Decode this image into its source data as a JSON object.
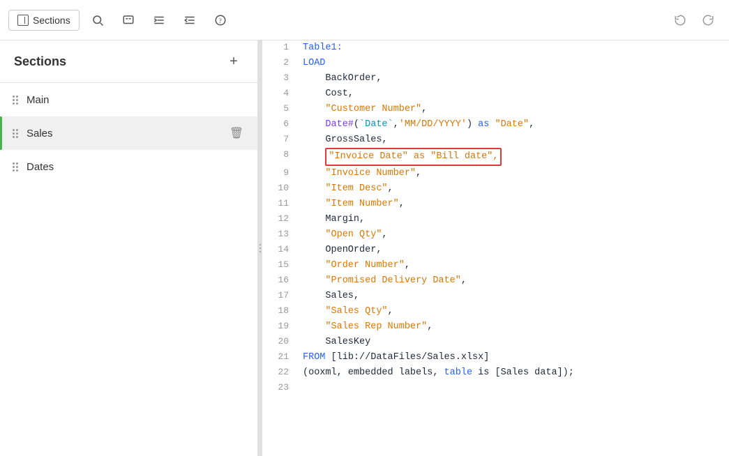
{
  "toolbar": {
    "sections_label": "Sections",
    "icons": [
      {
        "name": "search-icon",
        "symbol": "🔍"
      },
      {
        "name": "comment-icon",
        "symbol": "//"
      },
      {
        "name": "indent-icon",
        "symbol": "⇥"
      },
      {
        "name": "outdent-icon",
        "symbol": "⇤"
      },
      {
        "name": "help-icon",
        "symbol": "?"
      },
      {
        "name": "undo-icon",
        "symbol": "↩"
      },
      {
        "name": "redo-icon",
        "symbol": "↪"
      }
    ]
  },
  "sidebar": {
    "title": "Sections",
    "add_label": "+",
    "items": [
      {
        "name": "Main",
        "active": false
      },
      {
        "name": "Sales",
        "active": true
      },
      {
        "name": "Dates",
        "active": false
      }
    ]
  },
  "editor": {
    "lines": [
      {
        "num": 1,
        "tokens": [
          {
            "text": "Table1:",
            "color": "blue"
          }
        ]
      },
      {
        "num": 2,
        "tokens": [
          {
            "text": "LOAD",
            "color": "blue"
          }
        ]
      },
      {
        "num": 3,
        "tokens": [
          {
            "text": "    BackOrder",
            "color": "dark"
          },
          {
            "text": ",",
            "color": "dark"
          }
        ]
      },
      {
        "num": 4,
        "tokens": [
          {
            "text": "    Cost",
            "color": "dark"
          },
          {
            "text": ",",
            "color": "dark"
          }
        ]
      },
      {
        "num": 5,
        "tokens": [
          {
            "text": "    ",
            "color": "dark"
          },
          {
            "text": "\"Customer Number\"",
            "color": "orange"
          },
          {
            "text": ",",
            "color": "dark"
          }
        ]
      },
      {
        "num": 6,
        "tokens": [
          {
            "text": "    ",
            "color": "dark"
          },
          {
            "text": "Date#",
            "color": "purple"
          },
          {
            "text": "(",
            "color": "dark"
          },
          {
            "text": "`Date`",
            "color": "teal"
          },
          {
            "text": ",",
            "color": "dark"
          },
          {
            "text": "'MM/DD/YYYY'",
            "color": "orange"
          },
          {
            "text": ") ",
            "color": "dark"
          },
          {
            "text": "as",
            "color": "blue"
          },
          {
            "text": " ",
            "color": "dark"
          },
          {
            "text": "\"Date\"",
            "color": "orange"
          },
          {
            "text": ",",
            "color": "dark"
          }
        ]
      },
      {
        "num": 7,
        "tokens": [
          {
            "text": "    GrossSales",
            "color": "dark"
          },
          {
            "text": ",",
            "color": "dark"
          }
        ]
      },
      {
        "num": 8,
        "tokens": [
          {
            "text": "    ",
            "color": "dark"
          },
          {
            "text": "\"Invoice Date\" as \"Bill date\",",
            "color": "orange",
            "highlight": true
          }
        ],
        "highlighted": true
      },
      {
        "num": 9,
        "tokens": [
          {
            "text": "    ",
            "color": "dark"
          },
          {
            "text": "\"Invoice Number\"",
            "color": "orange"
          },
          {
            "text": ",",
            "color": "dark"
          }
        ]
      },
      {
        "num": 10,
        "tokens": [
          {
            "text": "    ",
            "color": "dark"
          },
          {
            "text": "\"Item Desc\"",
            "color": "orange"
          },
          {
            "text": ",",
            "color": "dark"
          }
        ]
      },
      {
        "num": 11,
        "tokens": [
          {
            "text": "    ",
            "color": "dark"
          },
          {
            "text": "\"Item Number\"",
            "color": "orange"
          },
          {
            "text": ",",
            "color": "dark"
          }
        ]
      },
      {
        "num": 12,
        "tokens": [
          {
            "text": "    Margin",
            "color": "dark"
          },
          {
            "text": ",",
            "color": "dark"
          }
        ]
      },
      {
        "num": 13,
        "tokens": [
          {
            "text": "    ",
            "color": "dark"
          },
          {
            "text": "\"Open Qty\"",
            "color": "orange"
          },
          {
            "text": ",",
            "color": "dark"
          }
        ]
      },
      {
        "num": 14,
        "tokens": [
          {
            "text": "    OpenOrder",
            "color": "dark"
          },
          {
            "text": ",",
            "color": "dark"
          }
        ]
      },
      {
        "num": 15,
        "tokens": [
          {
            "text": "    ",
            "color": "dark"
          },
          {
            "text": "\"Order Number\"",
            "color": "orange"
          },
          {
            "text": ",",
            "color": "dark"
          }
        ]
      },
      {
        "num": 16,
        "tokens": [
          {
            "text": "    ",
            "color": "dark"
          },
          {
            "text": "\"Promised Delivery Date\"",
            "color": "orange"
          },
          {
            "text": ",",
            "color": "dark"
          }
        ]
      },
      {
        "num": 17,
        "tokens": [
          {
            "text": "    Sales",
            "color": "dark"
          },
          {
            "text": ",",
            "color": "dark"
          }
        ]
      },
      {
        "num": 18,
        "tokens": [
          {
            "text": "    ",
            "color": "dark"
          },
          {
            "text": "\"Sales Qty\"",
            "color": "orange"
          },
          {
            "text": ",",
            "color": "dark"
          }
        ]
      },
      {
        "num": 19,
        "tokens": [
          {
            "text": "    ",
            "color": "dark"
          },
          {
            "text": "\"Sales Rep Number\"",
            "color": "orange"
          },
          {
            "text": ",",
            "color": "dark"
          }
        ]
      },
      {
        "num": 20,
        "tokens": [
          {
            "text": "    SalesKey",
            "color": "dark"
          }
        ]
      },
      {
        "num": 21,
        "tokens": [
          {
            "text": "FROM ",
            "color": "blue"
          },
          {
            "text": "[lib://DataFiles/Sales.xlsx]",
            "color": "dark"
          }
        ]
      },
      {
        "num": 22,
        "tokens": [
          {
            "text": "(",
            "color": "dark"
          },
          {
            "text": "ooxml",
            "color": "dark"
          },
          {
            "text": ", embedded labels, ",
            "color": "dark"
          },
          {
            "text": "table",
            "color": "blue"
          },
          {
            "text": " is ",
            "color": "dark"
          },
          {
            "text": "[Sales data]",
            "color": "dark"
          },
          {
            "text": ");",
            "color": "dark"
          }
        ]
      },
      {
        "num": 23,
        "tokens": [
          {
            "text": "",
            "color": "dark"
          }
        ]
      }
    ]
  }
}
